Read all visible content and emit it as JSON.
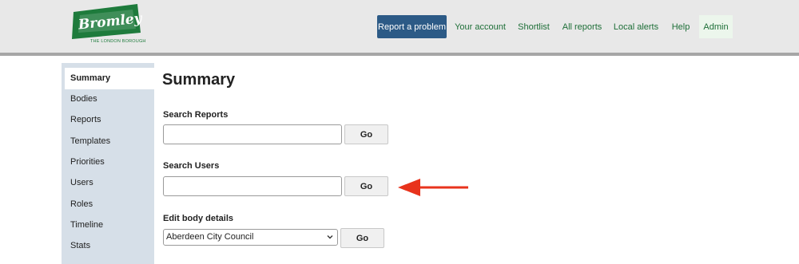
{
  "brand": {
    "logo_text": "Bromley",
    "tagline": "THE LONDON BOROUGH"
  },
  "nav": {
    "report_problem": "Report a problem",
    "your_account": "Your account",
    "shortlist": "Shortlist",
    "all_reports": "All reports",
    "local_alerts": "Local alerts",
    "help": "Help",
    "admin": "Admin"
  },
  "sidebar": {
    "items": [
      {
        "label": "Summary",
        "active": true
      },
      {
        "label": "Bodies"
      },
      {
        "label": "Reports"
      },
      {
        "label": "Templates"
      },
      {
        "label": "Priorities"
      },
      {
        "label": "Users"
      },
      {
        "label": "Roles"
      },
      {
        "label": "Timeline"
      },
      {
        "label": "Stats"
      }
    ]
  },
  "main": {
    "title": "Summary",
    "search_reports": {
      "label": "Search Reports",
      "value": "",
      "button": "Go"
    },
    "search_users": {
      "label": "Search Users",
      "value": "",
      "button": "Go"
    },
    "edit_body": {
      "label": "Edit body details",
      "selected": "Aberdeen City Council",
      "button": "Go"
    }
  },
  "colors": {
    "brand_green": "#1e7b3c",
    "primary_button": "#2c5a86",
    "sidebar_bg": "#d6dfe8",
    "annotation_arrow": "#e8331c"
  }
}
